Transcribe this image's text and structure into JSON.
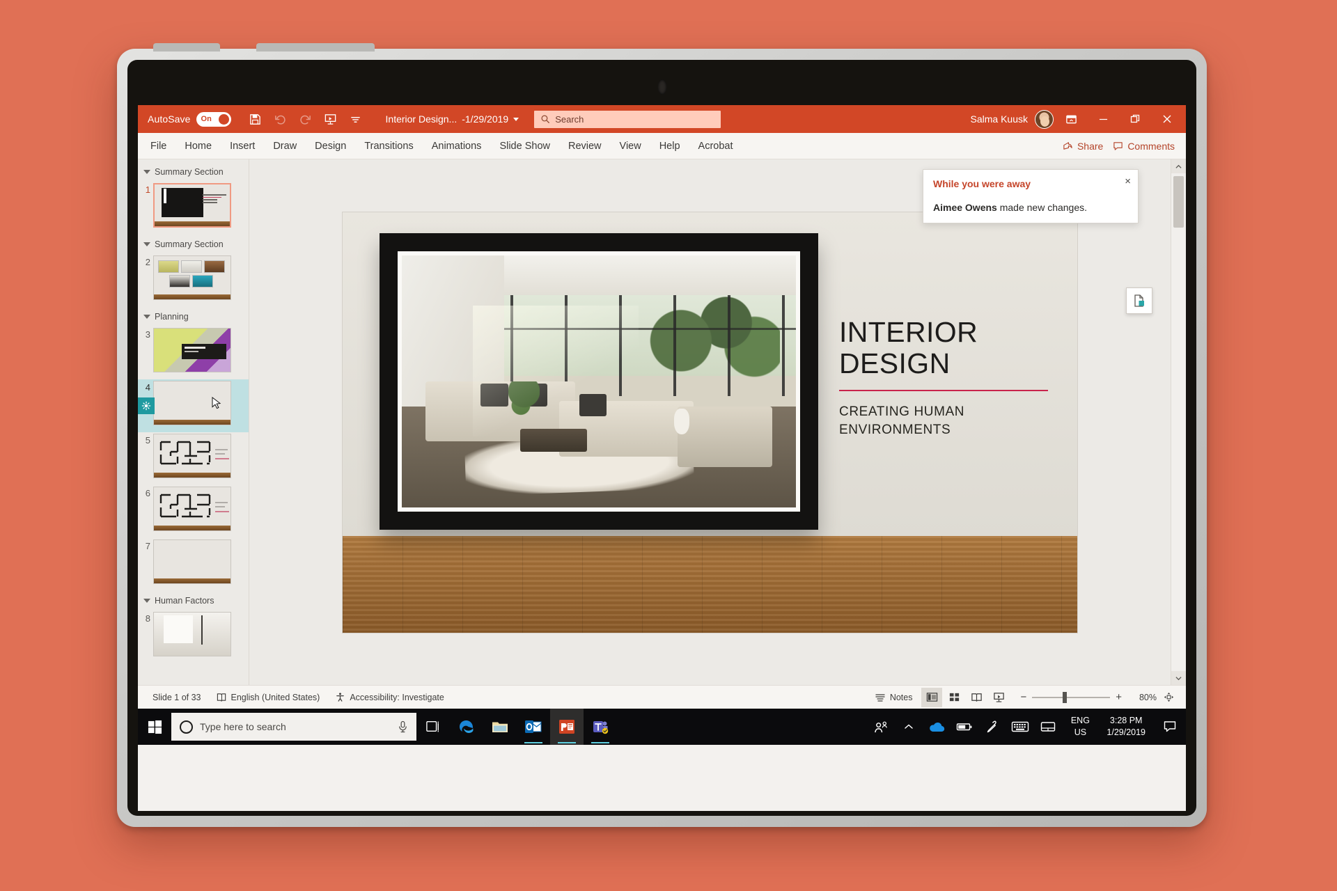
{
  "titlebar": {
    "autosave_label": "AutoSave",
    "autosave_state": "On",
    "doc_title": "Interior Design...",
    "doc_date": "-1/29/2019",
    "search_placeholder": "Search",
    "user_name": "Salma Kuusk",
    "qat": [
      {
        "name": "save-icon",
        "label": "Save"
      },
      {
        "name": "undo-icon",
        "label": "Undo"
      },
      {
        "name": "redo-icon",
        "label": "Redo"
      },
      {
        "name": "start-presentation-icon",
        "label": "Start From Beginning"
      },
      {
        "name": "customize-quick-access-icon",
        "label": "Customize Quick Access Toolbar"
      }
    ],
    "window_buttons": [
      {
        "name": "ribbon-display-options-button",
        "label": "Ribbon Display Options"
      },
      {
        "name": "minimize-button",
        "label": "Minimize"
      },
      {
        "name": "restore-button",
        "label": "Restore Down"
      },
      {
        "name": "close-button",
        "label": "Close"
      }
    ],
    "accent": "#d24726"
  },
  "ribbon": {
    "tabs": [
      {
        "label": "File"
      },
      {
        "label": "Home"
      },
      {
        "label": "Insert"
      },
      {
        "label": "Draw"
      },
      {
        "label": "Design"
      },
      {
        "label": "Transitions"
      },
      {
        "label": "Animations"
      },
      {
        "label": "Slide Show"
      },
      {
        "label": "Review"
      },
      {
        "label": "View"
      },
      {
        "label": "Help"
      },
      {
        "label": "Acrobat"
      }
    ],
    "share_label": "Share",
    "comments_label": "Comments"
  },
  "notification": {
    "title": "While you were away",
    "author": "Aimee Owens",
    "message": " made new changes.",
    "close_label": "×"
  },
  "slide_panel": {
    "sections": [
      {
        "name": "Summary Section",
        "slides": [
          {
            "number": "1",
            "type": "title-art",
            "selected": false,
            "current": true
          }
        ]
      },
      {
        "name": "Summary Section",
        "slides": [
          {
            "number": "2",
            "type": "grid",
            "selected": false,
            "current": false
          }
        ]
      },
      {
        "name": "Planning",
        "slides": [
          {
            "number": "3",
            "type": "photo-dark",
            "selected": false,
            "current": false
          },
          {
            "number": "4",
            "type": "bullets",
            "selected": true,
            "current": false
          },
          {
            "number": "5",
            "type": "floorplan",
            "selected": false,
            "current": false
          },
          {
            "number": "6",
            "type": "floorplan",
            "selected": false,
            "current": false
          },
          {
            "number": "7",
            "type": "bullets",
            "selected": false,
            "current": false
          }
        ]
      },
      {
        "name": "Human Factors",
        "slides": [
          {
            "number": "8",
            "type": "photo",
            "selected": false,
            "current": false
          }
        ]
      }
    ]
  },
  "slide": {
    "title_line1": "INTERIOR",
    "title_line2": "DESIGN",
    "subtitle_line1": "CREATING HUMAN",
    "subtitle_line2": "ENVIRONMENTS",
    "rule_color": "#c9234b"
  },
  "statusbar": {
    "slide_counter": "Slide 1 of 33",
    "language": "English (United States)",
    "accessibility": "Accessibility: Investigate",
    "notes_label": "Notes",
    "views": [
      {
        "name": "normal-view-button",
        "label": "Normal",
        "selected": true
      },
      {
        "name": "slide-sorter-button",
        "label": "Slide Sorter",
        "selected": false
      },
      {
        "name": "reading-view-button",
        "label": "Reading View",
        "selected": false
      },
      {
        "name": "slideshow-button",
        "label": "Slide Show",
        "selected": false
      }
    ],
    "zoom_out_label": "−",
    "zoom_in_label": "+",
    "zoom_percent": "80%",
    "fit_label": "Fit slide to current window"
  },
  "taskbar": {
    "search_placeholder": "Type here to search",
    "apps": [
      {
        "name": "task-view-icon",
        "label": "Task View",
        "active": false
      },
      {
        "name": "edge-icon",
        "label": "Microsoft Edge",
        "active": false
      },
      {
        "name": "file-explorer-icon",
        "label": "File Explorer",
        "active": false
      },
      {
        "name": "outlook-icon",
        "label": "Outlook",
        "active": false
      },
      {
        "name": "powerpoint-icon",
        "label": "PowerPoint",
        "active": true
      },
      {
        "name": "teams-icon",
        "label": "Microsoft Teams",
        "active": false
      }
    ],
    "tray": [
      {
        "name": "people-icon",
        "label": "People"
      },
      {
        "name": "show-hidden-icons-icon",
        "label": "Show hidden icons"
      },
      {
        "name": "onedrive-icon",
        "label": "OneDrive"
      },
      {
        "name": "battery-icon",
        "label": "Battery"
      },
      {
        "name": "pen-icon",
        "label": "Windows Ink"
      },
      {
        "name": "keyboard-icon",
        "label": "Touch keyboard"
      },
      {
        "name": "touchpad-icon",
        "label": "Touchpad"
      }
    ],
    "language_line1": "ENG",
    "language_line2": "US",
    "clock_time": "3:28 PM",
    "clock_date": "1/29/2019"
  }
}
